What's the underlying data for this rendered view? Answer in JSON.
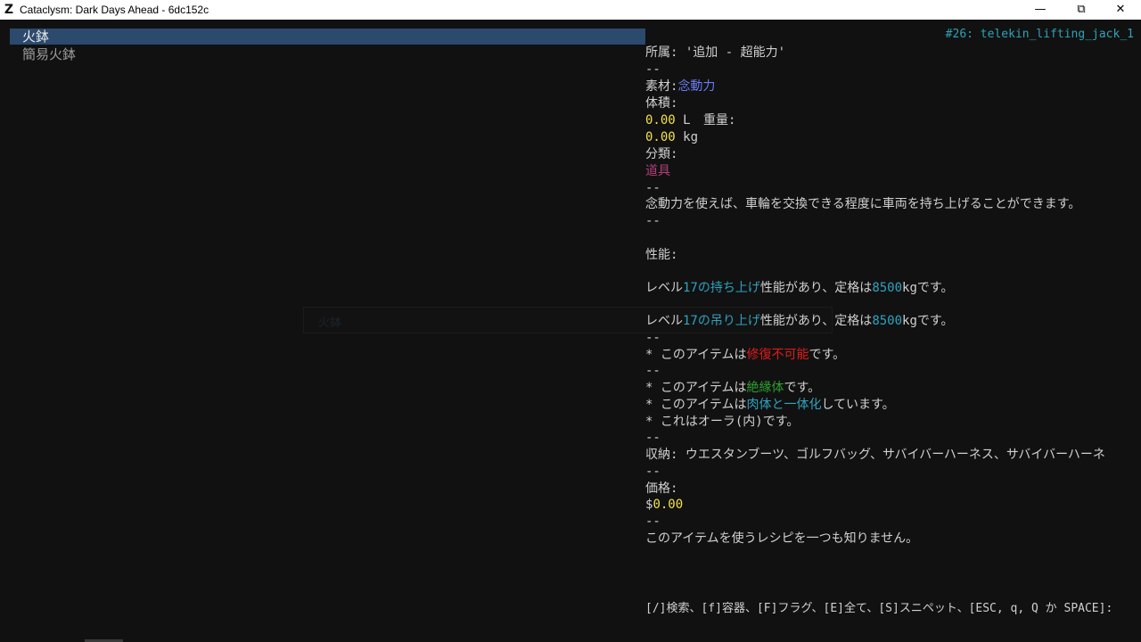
{
  "window": {
    "title": "Cataclysm: Dark Days Ahead - 6dc152c",
    "icon_glyph": "Z",
    "minimize": "—",
    "restore": "⧉",
    "close": "✕"
  },
  "list": {
    "items": [
      {
        "label": "火鉢",
        "selected": true
      },
      {
        "label": "簡易火鉢",
        "selected": false
      }
    ]
  },
  "ghost_overlay": {
    "text": "火鉢"
  },
  "info": {
    "recipe_id": "#26: telekin_lifting_jack_1",
    "category_label": "所属:",
    "category_value": "'追加 - 超能力'",
    "sep": "--",
    "material_label": "素材:",
    "material_value": "念動力",
    "volume_label": "体積:",
    "volume_value": "0.00",
    "volume_unit": "L",
    "weight_label": "重量:",
    "weight_value": "0.00",
    "weight_unit": "kg",
    "type_label": "分類:",
    "type_value": "道具",
    "description": "念動力を使えば、車輪を交換できる程度に車両を持ち上げることができます。",
    "qualities_label": "性能:",
    "quality1": {
      "pre": "レベル",
      "level": "17の持ち上げ",
      "mid": "性能があり、定格は",
      "amount": "8500",
      "post": "kgです。"
    },
    "quality2": {
      "pre": "レベル",
      "level": "17の吊り上げ",
      "mid": "性能があり、定格は",
      "amount": "8500",
      "post": "kgです。"
    },
    "flag1": {
      "pre": "* このアイテムは",
      "highlight": "修復不可能",
      "post": "です。"
    },
    "flag2": {
      "pre": "* このアイテムは",
      "highlight": "絶縁体",
      "post": "です。"
    },
    "flag3": {
      "pre": "* このアイテムは",
      "highlight": "肉体と一体化",
      "post": "しています。"
    },
    "flag4": "* これはオーラ(内)です。",
    "storage": "収納: ウエスタンブーツ、ゴルフバッグ、サバイバーハーネス、サバイバーハーネ",
    "price_label": "価格:",
    "price_symbol": "$",
    "price_value": "0.00",
    "recipes_note": "このアイテムを使うレシピを一つも知りません。",
    "keys_help": "[/]検索、[f]容器、[F]フラグ、[E]全て、[S]スニペット、[ESC, q, Q か SPACE]:"
  },
  "colors": {
    "background": "#111111",
    "selection": "#2b4a6e",
    "yellow": "#f2e14a",
    "blue": "#6a7cf2",
    "cyan": "#2fa3c0",
    "magenta": "#b0407a",
    "red": "#e21b1b",
    "green": "#2ea032"
  }
}
